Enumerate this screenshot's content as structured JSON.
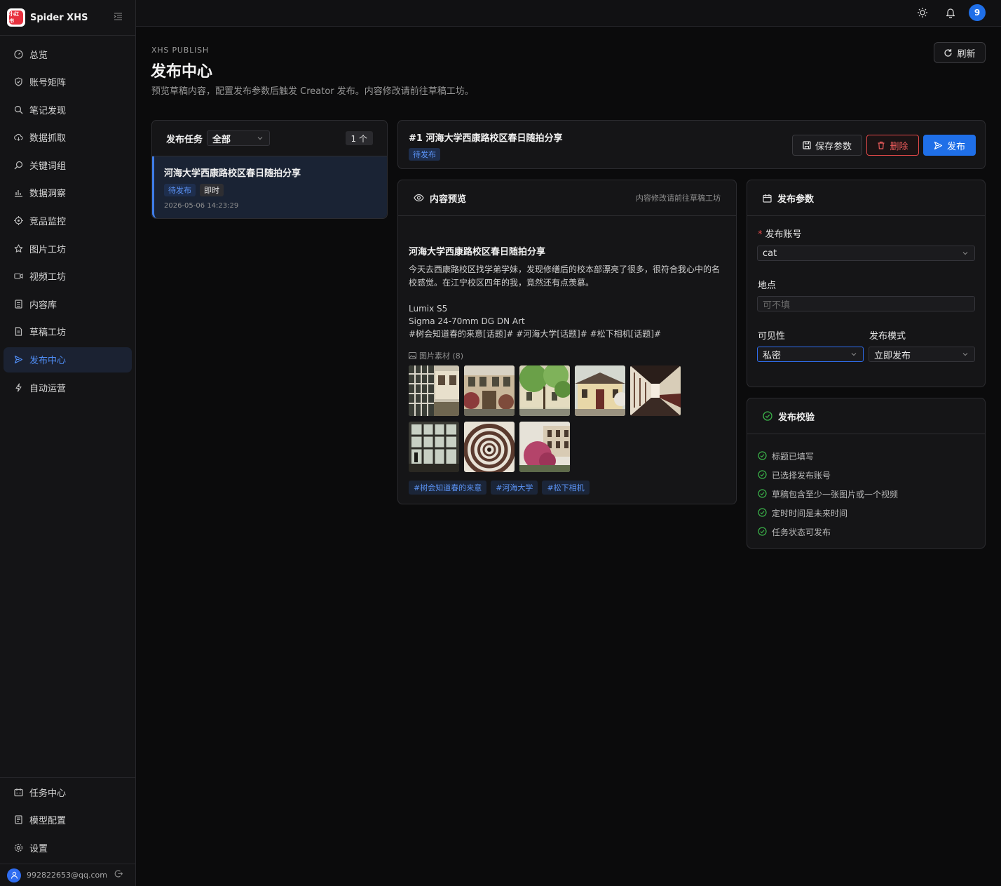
{
  "app": {
    "name": "Spider XHS",
    "logo_text": "小红书"
  },
  "nav": {
    "items": [
      {
        "label": "总览",
        "icon": "dashboard-icon"
      },
      {
        "label": "账号矩阵",
        "icon": "shield-icon"
      },
      {
        "label": "笔记发现",
        "icon": "search-icon"
      },
      {
        "label": "数据抓取",
        "icon": "cloud-icon"
      },
      {
        "label": "关键词组",
        "icon": "key-search-icon"
      },
      {
        "label": "数据洞察",
        "icon": "bar-chart-icon"
      },
      {
        "label": "竞品监控",
        "icon": "target-icon"
      },
      {
        "label": "图片工坊",
        "icon": "star-icon"
      },
      {
        "label": "视频工坊",
        "icon": "video-icon"
      },
      {
        "label": "内容库",
        "icon": "library-icon"
      },
      {
        "label": "草稿工坊",
        "icon": "document-icon"
      },
      {
        "label": "发布中心",
        "icon": "send-icon",
        "active": true
      },
      {
        "label": "自动运营",
        "icon": "lightning-icon"
      }
    ],
    "bottom_items": [
      {
        "label": "任务中心",
        "icon": "calendar-task-icon"
      },
      {
        "label": "模型配置",
        "icon": "model-icon"
      },
      {
        "label": "设置",
        "icon": "gear-icon"
      }
    ]
  },
  "user": {
    "email": "992822653@qq.com"
  },
  "topbar": {
    "notification_count": "9"
  },
  "header": {
    "eyebrow": "XHS PUBLISH",
    "title": "发布中心",
    "description": "预览草稿内容，配置发布参数后触发 Creator 发布。内容修改请前往草稿工坊。",
    "refresh_label": "刷新"
  },
  "tasks": {
    "label": "发布任务",
    "filter_value": "全部",
    "count": "1 个",
    "items": [
      {
        "title": "河海大学西康路校区春日随拍分享",
        "status": "待发布",
        "mode": "即时",
        "time": "2026-05-06 14:23:29"
      }
    ]
  },
  "detail": {
    "title": "#1 河海大学西康路校区春日随拍分享",
    "status": "待发布",
    "save_label": "保存参数",
    "delete_label": "删除",
    "publish_label": "发布"
  },
  "preview": {
    "heading": "内容预览",
    "hint": "内容修改请前往草稿工坊",
    "title": "河海大学西康路校区春日随拍分享",
    "body": "今天去西康路校区找学弟学妹，发现修缮后的校本部漂亮了很多，很符合我心中的名校感觉。在江宁校区四年的我，竟然还有点羡慕。",
    "lines": [
      "Lumix S5",
      "Sigma 24-70mm DG DN Art",
      "#树会知道春的来意[话题]# #河海大学[话题]# #松下相机[话题]#"
    ],
    "assets_label": "图片素材 (8)",
    "images": [
      {
        "name": "image-window-grid"
      },
      {
        "name": "image-building-roses"
      },
      {
        "name": "image-green-trees"
      },
      {
        "name": "image-yellow-house"
      },
      {
        "name": "image-corridor"
      },
      {
        "name": "image-tall-windows"
      },
      {
        "name": "image-spiral-stairs"
      },
      {
        "name": "image-pink-tree"
      }
    ],
    "hashtags": [
      "#树会知道春的来意",
      "#河海大学",
      "#松下相机"
    ]
  },
  "params": {
    "heading": "发布参数",
    "account_label": "发布账号",
    "account_value": "cat",
    "location_label": "地点",
    "location_placeholder": "可不填",
    "visibility_label": "可见性",
    "visibility_value": "私密",
    "mode_label": "发布模式",
    "mode_value": "立即发布"
  },
  "checks": {
    "heading": "发布校验",
    "items": [
      "标题已填写",
      "已选择发布账号",
      "草稿包含至少一张图片或一个视频",
      "定时时间是未来时间",
      "任务状态可发布"
    ]
  },
  "colors": {
    "accent": "#1f6fe8",
    "danger": "#e04848",
    "success": "#3bb54a"
  }
}
